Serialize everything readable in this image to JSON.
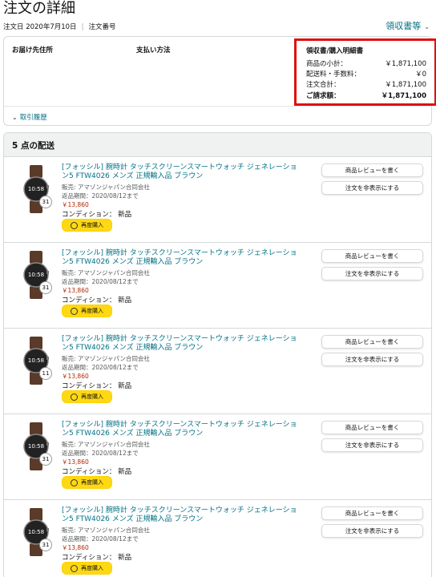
{
  "page": {
    "title": "注文の詳細"
  },
  "meta": {
    "order_date": "注文日 2020年7月10日",
    "order_number_label": "注文番号"
  },
  "receipt_link": {
    "label": "領収書等",
    "icon": "chevron-down-icon"
  },
  "summary": {
    "shipping_address_label": "お届け先住所",
    "payment_method_label": "支払い方法",
    "receipt": {
      "title": "領収書/購入明細書",
      "rows": [
        {
          "label": "商品の小計：",
          "value": "￥1,871,100"
        },
        {
          "label": "配送料・手数料：",
          "value": "￥0"
        },
        {
          "label": "注文合計：",
          "value": "￥1,871,100"
        }
      ],
      "total": {
        "label": "ご請求額：",
        "value": "￥1,871,100"
      }
    },
    "history_link": "取引履歴"
  },
  "shipment": {
    "header": "5 点の配送",
    "items": [
      {
        "title": "[フォッシル] 腕時計 タッチスクリーンスマートウォッチ ジェネレーション5 FTW4026 メンズ 正規輸入品 ブラウン",
        "seller": "販売: アマゾンジャパン合同会社",
        "return": "返品期間：2020/08/12まで",
        "price": "￥13,860",
        "condition": "コンディション： 新品",
        "qty": "31",
        "buy_again": "再度購入",
        "review": "商品レビューを書く",
        "hide": "注文を非表示にする"
      },
      {
        "title": "[フォッシル] 腕時計 タッチスクリーンスマートウォッチ ジェネレーション5 FTW4026 メンズ 正規輸入品 ブラウン",
        "seller": "販売: アマゾンジャパン合同会社",
        "return": "返品期間：2020/08/12まで",
        "price": "￥13,860",
        "condition": "コンディション： 新品",
        "qty": "31",
        "buy_again": "再度購入",
        "review": "商品レビューを書く",
        "hide": "注文を非表示にする"
      },
      {
        "title": "[フォッシル] 腕時計 タッチスクリーンスマートウォッチ ジェネレーション5 FTW4026 メンズ 正規輸入品 ブラウン",
        "seller": "販売: アマゾンジャパン合同会社",
        "return": "返品期間：2020/08/12まで",
        "price": "￥13,860",
        "condition": "コンディション： 新品",
        "qty": "11",
        "buy_again": "再度購入",
        "review": "商品レビューを書く",
        "hide": "注文を非表示にする"
      },
      {
        "title": "[フォッシル] 腕時計 タッチスクリーンスマートウォッチ ジェネレーション5 FTW4026 メンズ 正規輸入品 ブラウン",
        "seller": "販売: アマゾンジャパン合同会社",
        "return": "返品期間：2020/08/12まで",
        "price": "￥13,860",
        "condition": "コンディション： 新品",
        "qty": "31",
        "buy_again": "再度購入",
        "review": "商品レビューを書く",
        "hide": "注文を非表示にする"
      },
      {
        "title": "[フォッシル] 腕時計 タッチスクリーンスマートウォッチ ジェネレーション5 FTW4026 メンズ 正規輸入品 ブラウン",
        "seller": "販売: アマゾンジャパン合同会社",
        "return": "返品期間：2020/08/12まで",
        "price": "￥13,860",
        "condition": "コンディション： 新品",
        "qty": "31",
        "buy_again": "再度購入",
        "review": "商品レビューを書く",
        "hide": "注文を非表示にする"
      }
    ]
  },
  "colors": {
    "link": "#007185",
    "highlight_border": "#e01010",
    "buy_again": "#ffd814",
    "price": "#b12704"
  }
}
